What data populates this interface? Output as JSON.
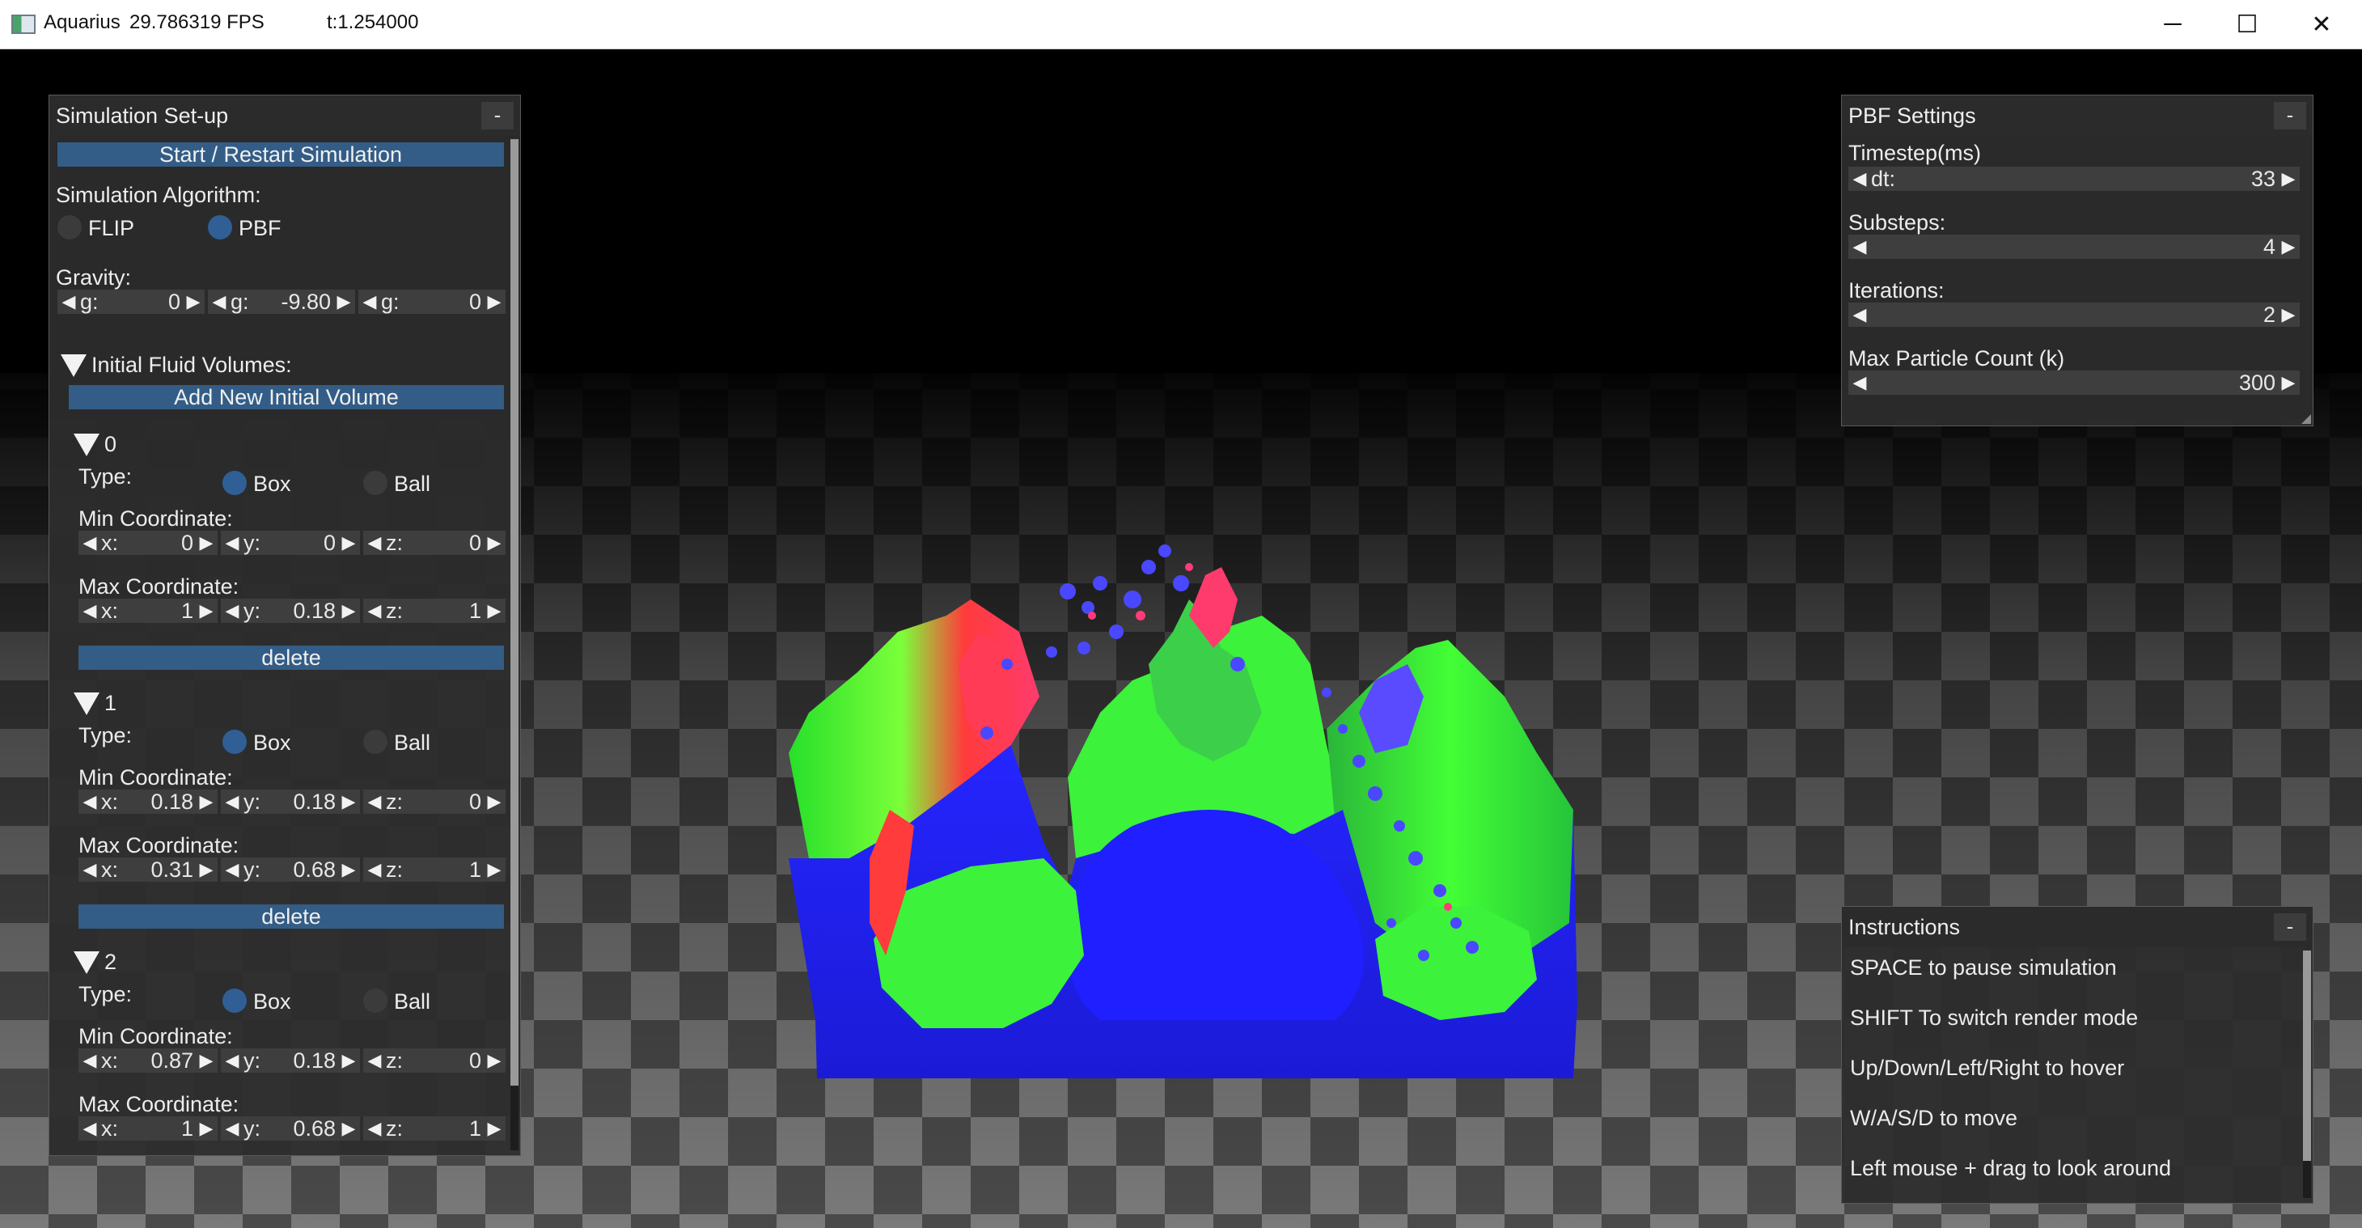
{
  "titlebar": {
    "app_name": "Aquarius",
    "fps": "29.786319 FPS",
    "time": "t:1.254000",
    "minimize_glyph": "─",
    "maximize_glyph": "☐",
    "close_glyph": "✕"
  },
  "setup": {
    "title": "Simulation Set-up",
    "collapse": "-",
    "start_button": "Start / Restart Simulation",
    "algorithm_label": "Simulation Algorithm:",
    "algorithms": [
      "FLIP",
      "PBF"
    ],
    "selected_algorithm": "PBF",
    "gravity_label": "Gravity:",
    "gravity": [
      {
        "label": "g:",
        "value": "0"
      },
      {
        "label": "g:",
        "value": "-9.80"
      },
      {
        "label": "g:",
        "value": "0"
      }
    ],
    "volumes_label": "Initial Fluid Volumes:",
    "add_button": "Add New Initial Volume",
    "type_label": "Type:",
    "box_label": "Box",
    "ball_label": "Ball",
    "min_label": "Min Coordinate:",
    "max_label": "Max Coordinate:",
    "delete_label": "delete",
    "axis_x": "x:",
    "axis_y": "y:",
    "axis_z": "z:",
    "volumes": [
      {
        "id": "0",
        "type": "Box",
        "min": {
          "x": "0",
          "y": "0",
          "z": "0"
        },
        "max": {
          "x": "1",
          "y": "0.18",
          "z": "1"
        }
      },
      {
        "id": "1",
        "type": "Box",
        "min": {
          "x": "0.18",
          "y": "0.18",
          "z": "0"
        },
        "max": {
          "x": "0.31",
          "y": "0.68",
          "z": "1"
        }
      },
      {
        "id": "2",
        "type": "Box",
        "min": {
          "x": "0.87",
          "y": "0.18",
          "z": "0"
        },
        "max": {
          "x": "1",
          "y": "0.68",
          "z": "1"
        }
      }
    ]
  },
  "pbf": {
    "title": "PBF Settings",
    "collapse": "-",
    "timestep_label": "Timestep(ms)",
    "dt_label": "dt:",
    "dt_value": "33",
    "substeps_label": "Substeps:",
    "substeps_value": "4",
    "iterations_label": "Iterations:",
    "iterations_value": "2",
    "max_particles_label": "Max Particle Count (k)",
    "max_particles_value": "300"
  },
  "instructions": {
    "title": "Instructions",
    "collapse": "-",
    "lines": [
      "SPACE to pause simulation",
      "SHIFT To switch render mode",
      "Up/Down/Left/Right to hover",
      "W/A/S/D to move",
      "Left mouse + drag to look around"
    ]
  },
  "colors": {
    "button": "#335d86",
    "radio_on": "#2f5f95",
    "fluid_blue": "#1a1aff",
    "fluid_green": "#33ff33",
    "fluid_red": "#ff3333"
  }
}
